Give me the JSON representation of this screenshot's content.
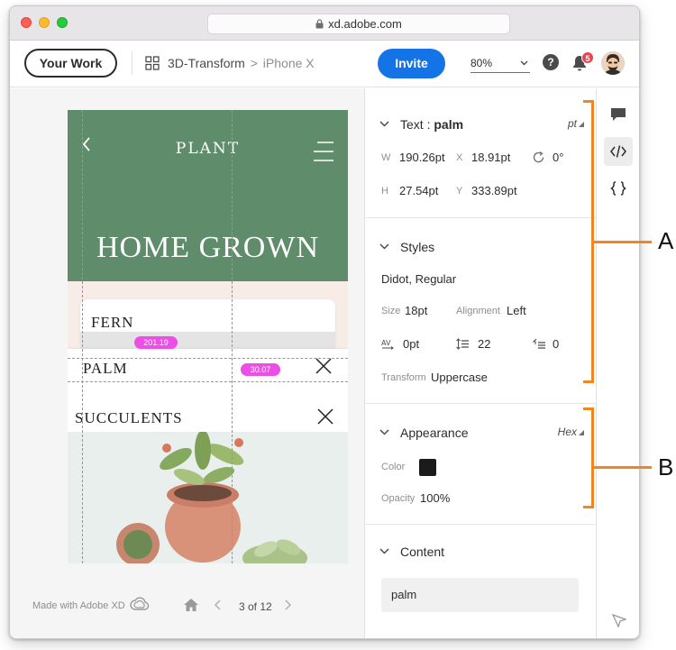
{
  "browser": {
    "url": "xd.adobe.com"
  },
  "toolbar": {
    "your_work_label": "Your Work",
    "breadcrumb_project": "3D-Transform",
    "breadcrumb_separator": ">",
    "breadcrumb_artboard": "iPhone X",
    "invite_label": "Invite",
    "zoom_value": "80%",
    "help_glyph": "?",
    "notification_count": "5"
  },
  "artboard": {
    "brand": "PLANT",
    "headline": "HOME GROWN",
    "cards": [
      "FERN",
      "PALM",
      "SUCCULENTS"
    ],
    "measure_width": "201.19",
    "measure_spacing": "30.07"
  },
  "canvas_footer": {
    "made_with": "Made with Adobe XD",
    "page_indicator": "3 of 12"
  },
  "inspect": {
    "text_section": {
      "title_prefix": "Text : ",
      "title_name": "palm",
      "unit": "pt",
      "w_label": "W",
      "w_value": "190.26pt",
      "x_label": "X",
      "x_value": "18.91pt",
      "rotation_value": "0°",
      "h_label": "H",
      "h_value": "27.54pt",
      "y_label": "Y",
      "y_value": "333.89pt"
    },
    "styles": {
      "title": "Styles",
      "font": "Didot, Regular",
      "size_label": "Size",
      "size_value": "18pt",
      "alignment_label": "Alignment",
      "alignment_value": "Left",
      "char_spacing_value": "0pt",
      "line_spacing_value": "22",
      "paragraph_spacing_value": "0",
      "transform_label": "Transform",
      "transform_value": "Uppercase"
    },
    "appearance": {
      "title": "Appearance",
      "unit": "Hex",
      "color_label": "Color",
      "color_value": "#1b1b1b",
      "opacity_label": "Opacity",
      "opacity_value": "100%"
    },
    "content": {
      "title": "Content",
      "value": "palm"
    }
  },
  "callouts": {
    "a": "A",
    "b": "B"
  },
  "colors": {
    "accent": "#1473e6",
    "hero_green": "#5f8c6b",
    "callout_orange": "#f2851f",
    "guide_magenta": "#ec4ee6"
  }
}
